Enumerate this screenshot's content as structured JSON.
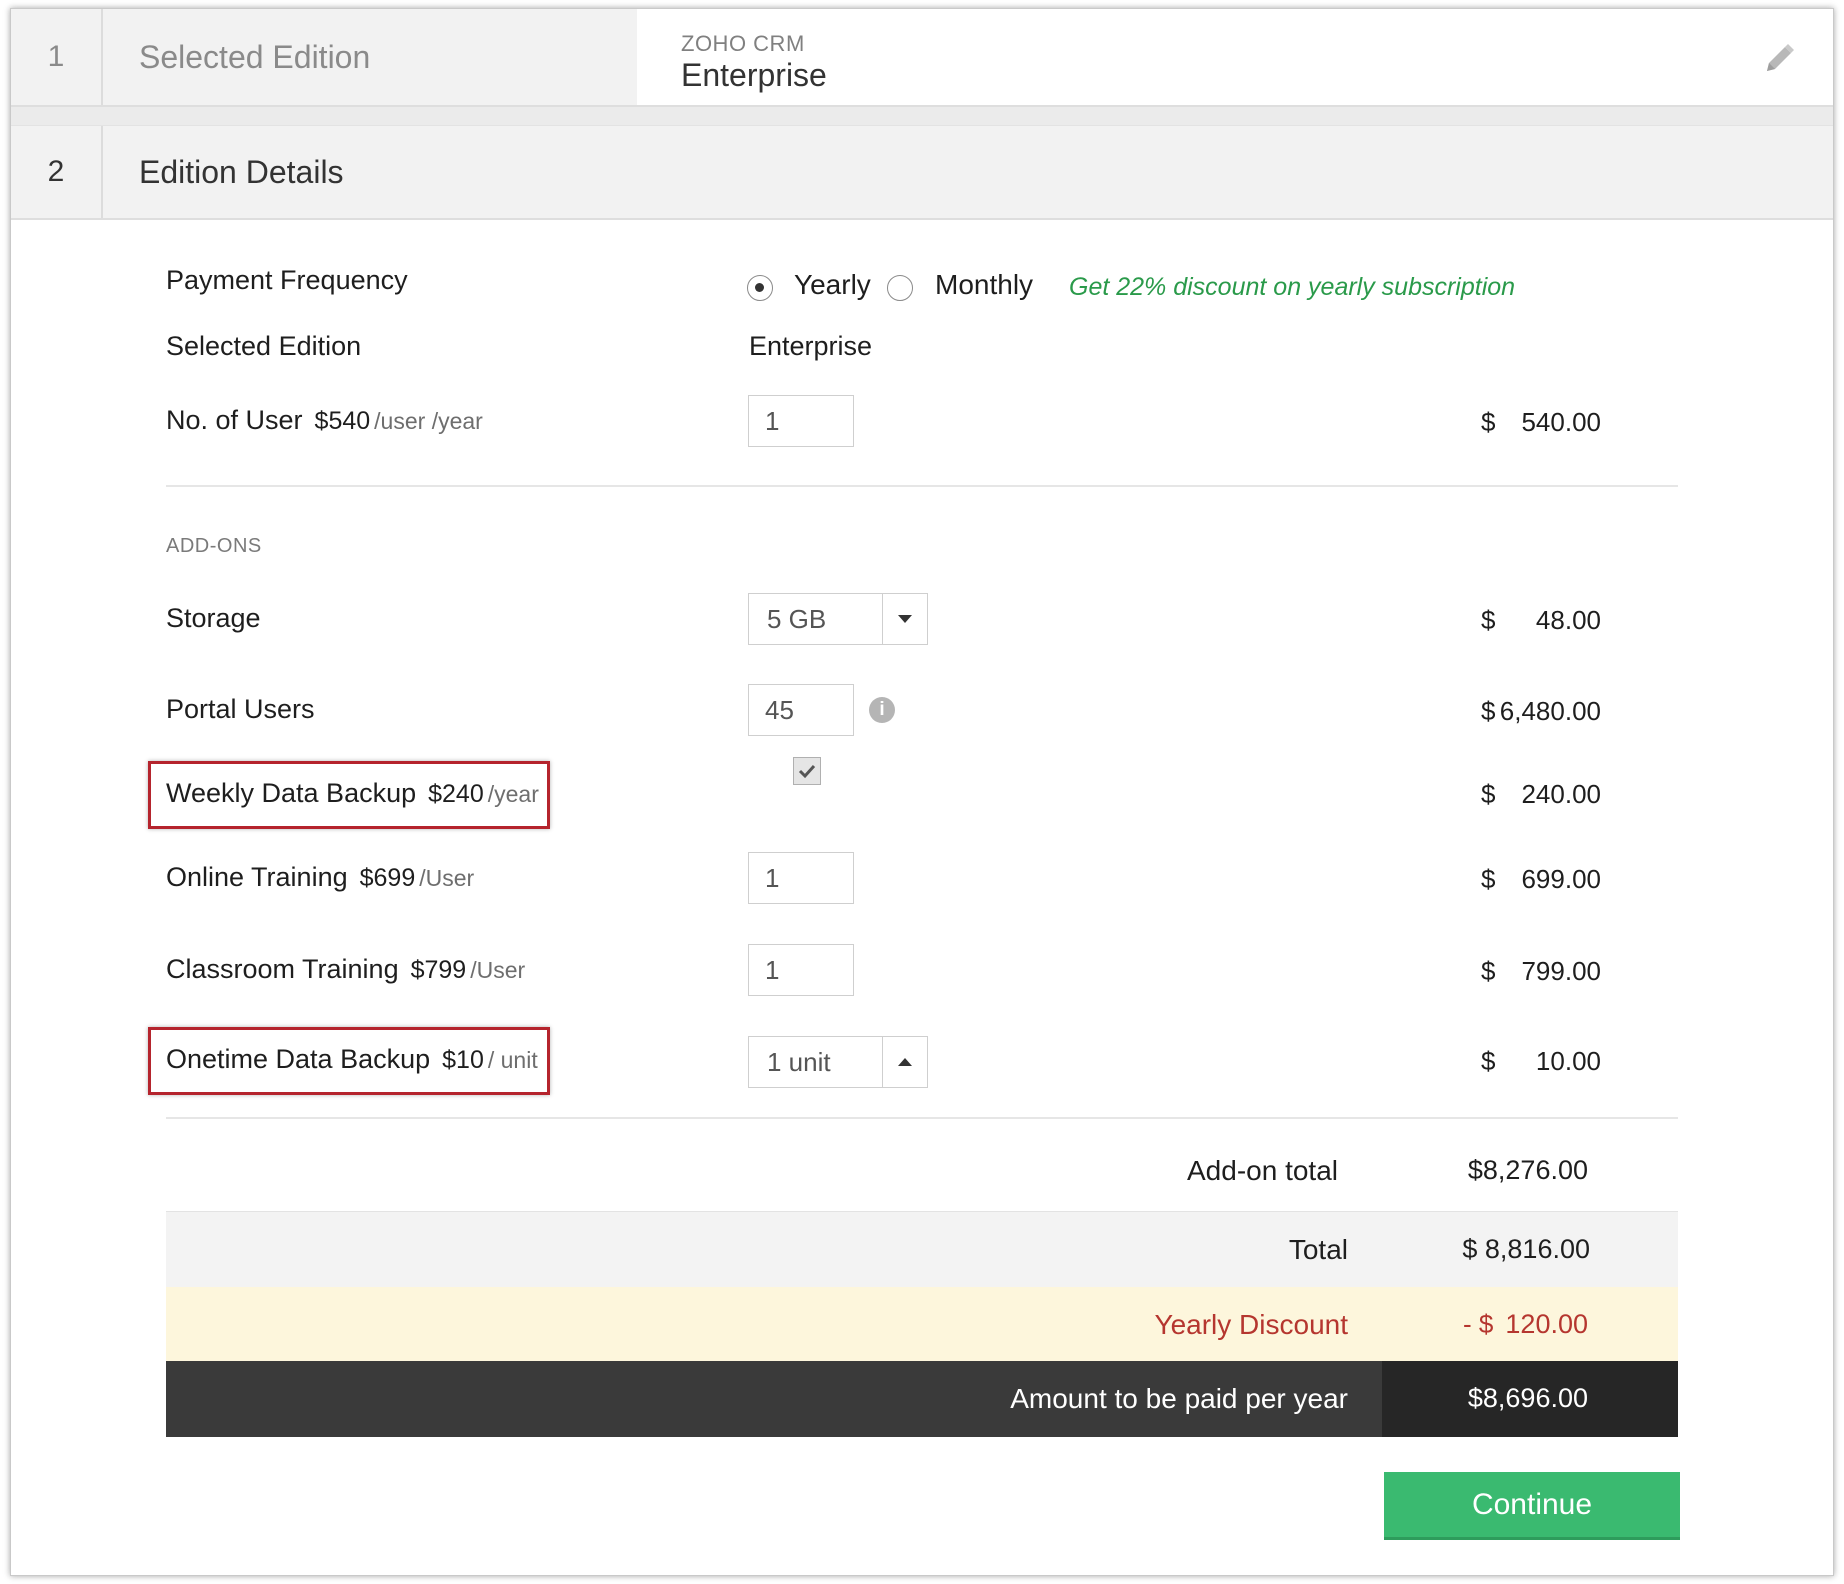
{
  "steps": {
    "step1": {
      "number": "1",
      "title": "Selected Edition",
      "brand": "ZOHO CRM",
      "edition": "Enterprise",
      "edit_icon": "pencil-icon"
    },
    "step2": {
      "number": "2",
      "title": "Edition Details"
    }
  },
  "payment": {
    "label": "Payment Frequency",
    "options": [
      {
        "label": "Yearly",
        "selected": true
      },
      {
        "label": "Monthly",
        "selected": false
      }
    ],
    "promo": "Get 22% discount on yearly subscription"
  },
  "selected_edition": {
    "label": "Selected Edition",
    "value": "Enterprise"
  },
  "users": {
    "label": "No. of User",
    "price": "$540",
    "unit": "/user /year",
    "value": "1",
    "currency": "$",
    "amount": "540.00"
  },
  "addons": {
    "heading": "ADD-ONS",
    "storage": {
      "label": "Storage",
      "value": "5 GB",
      "currency": "$",
      "amount": "48.00"
    },
    "portal_users": {
      "label": "Portal Users",
      "value": "45",
      "info_icon": "info-icon",
      "currency": "$",
      "amount": "6,480.00"
    },
    "weekly_backup": {
      "label": "Weekly Data Backup",
      "price": "$240",
      "unit": "/year",
      "checked": true,
      "currency": "$",
      "amount": "240.00"
    },
    "online_training": {
      "label": "Online Training",
      "price": "$699",
      "unit": "/User",
      "value": "1",
      "currency": "$",
      "amount": "699.00"
    },
    "classroom_training": {
      "label": "Classroom Training",
      "price": "$799",
      "unit": "/User",
      "value": "1",
      "currency": "$",
      "amount": "799.00"
    },
    "onetime_backup": {
      "label": "Onetime Data Backup",
      "price": "$10",
      "unit": "/ unit",
      "value": "1 unit",
      "currency": "$",
      "amount": "10.00"
    }
  },
  "summary": {
    "addon_total_label": "Add-on total",
    "addon_total_value": "$8,276.00",
    "total_label": "Total",
    "total_value": "$ 8,816.00",
    "discount_label": "Yearly Discount",
    "discount_prefix": "- $",
    "discount_value": "120.00",
    "pay_label": "Amount to be paid per year",
    "pay_value": "$8,696.00"
  },
  "continue_label": "Continue",
  "colors": {
    "promo_green": "#2a9a4a",
    "discount_red": "#b5362f",
    "highlight_red": "#b5242d",
    "continue_green": "#3aba70",
    "pay_bar": "#3a3a3a"
  }
}
